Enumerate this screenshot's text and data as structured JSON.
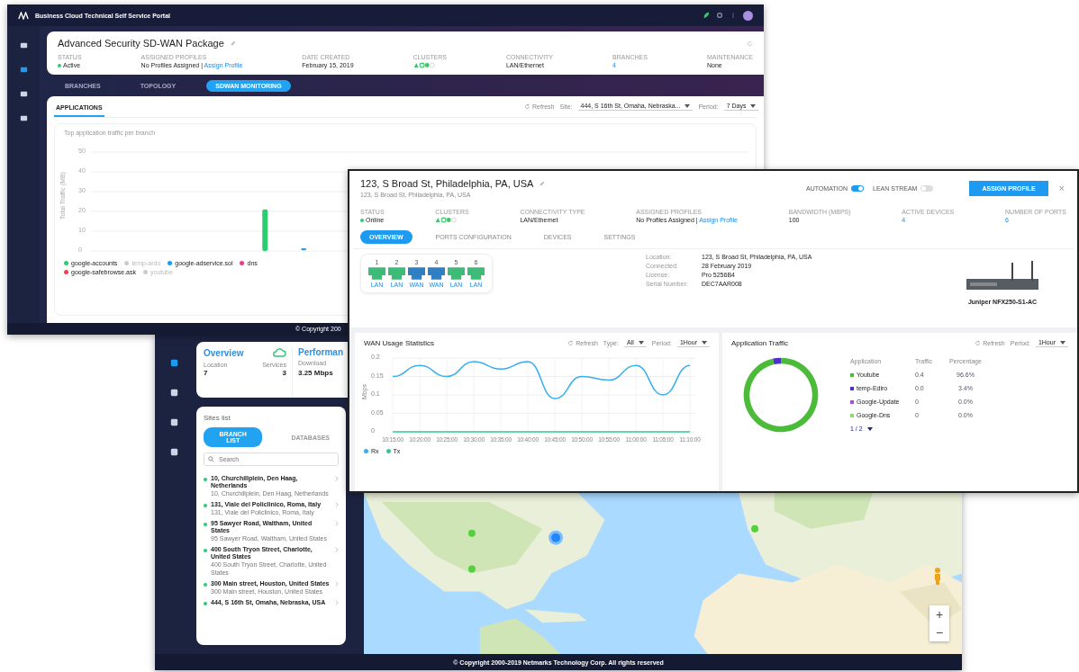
{
  "package_window": {
    "title": "Business Cloud Technical Self Service Portal",
    "sidebar": [
      {
        "selected": false
      },
      {
        "selected": true
      },
      {
        "selected": false
      },
      {
        "selected": false
      }
    ],
    "header": {
      "title": "Advanced Security SD-WAN Package",
      "fields": [
        {
          "label": "STATUS",
          "value": "Active",
          "kind": "status"
        },
        {
          "label": "ASSIGNED PROFILES",
          "value": "No Profiles Assigned |",
          "link": "Assign Profile",
          "kind": "link"
        },
        {
          "label": "DATE CREATED",
          "value": "February 15, 2019",
          "kind": "text"
        },
        {
          "label": "CLUSTERS",
          "kind": "clusters"
        },
        {
          "label": "CONNECTIVITY",
          "value": "LAN/Ethernet",
          "kind": "text"
        },
        {
          "label": "BRANCHES",
          "value": "4",
          "kind": "count"
        },
        {
          "label": "MAINTENANCE",
          "value": "None",
          "kind": "text"
        }
      ]
    },
    "tabs": [
      {
        "label": "BRANCHES",
        "selected": false
      },
      {
        "label": "TOPOLOGY",
        "selected": false
      },
      {
        "label": "SDWAN MONITORING",
        "selected": true
      }
    ],
    "subtabs": [
      {
        "label": "APPLICATIONS",
        "selected": true
      }
    ],
    "toolbar": {
      "refresh": "Refresh",
      "site_label": "Site:",
      "site": "444, S 16th St, Omaha, Nebraska...",
      "period_label": "Period:",
      "period": "7 Days"
    },
    "chart": {
      "title": "Top application traffic per branch",
      "chart_data": {
        "type": "bar",
        "ylabel": "Total Traffic (MB)",
        "ylim": [
          0,
          50
        ],
        "yticks": [
          0,
          10,
          20,
          30,
          40,
          50
        ],
        "grid": true,
        "legend": "bottom",
        "series": [
          {
            "name": "google-accounts",
            "color": "#2ecc71",
            "values": [
              null,
              null,
              null,
              null,
              21,
              null,
              null,
              null,
              null,
              null,
              null,
              null,
              null,
              null,
              null,
              null,
              null
            ]
          },
          {
            "name": "temp-ardo",
            "color": "#cccccc",
            "values": [
              null,
              null,
              null,
              null,
              null,
              null,
              null,
              null,
              null,
              null,
              null,
              null,
              null,
              null,
              null,
              null,
              null
            ]
          },
          {
            "name": "google-adservice.sol",
            "color": "#1e9bf0",
            "values": [
              null,
              null,
              null,
              null,
              null,
              1,
              null,
              null,
              null,
              null,
              null,
              null,
              null,
              null,
              null,
              null,
              null
            ]
          },
          {
            "name": "dns",
            "color": "#e83e8c",
            "values": [
              null,
              null,
              null,
              null,
              null,
              null,
              null,
              null,
              null,
              null,
              null,
              null,
              null,
              null,
              null,
              null,
              null
            ]
          },
          {
            "name": "google-safebrowse.ask",
            "color": "#f0434b",
            "values": [
              null,
              null,
              null,
              null,
              null,
              null,
              null,
              null,
              null,
              null,
              null,
              null,
              null,
              null,
              null,
              null,
              null
            ]
          },
          {
            "name": "youtube",
            "color": "#cccccc",
            "values": [
              null,
              null,
              null,
              null,
              null,
              null,
              null,
              null,
              null,
              null,
              null,
              null,
              null,
              null,
              null,
              null,
              null
            ]
          }
        ]
      },
      "legend_states": [
        {
          "hidden": false
        },
        {
          "hidden": true
        },
        {
          "hidden": false
        },
        {
          "hidden": false
        },
        {
          "hidden": false
        },
        {
          "hidden": true
        }
      ]
    },
    "footer": "© Copyright 200"
  },
  "sites_window": {
    "sidebar": [
      {
        "selected": true
      },
      {
        "selected": false
      },
      {
        "selected": false
      },
      {
        "selected": false
      }
    ],
    "overview": {
      "title": "Overview",
      "stats": [
        {
          "label": "Location",
          "value": "7"
        },
        {
          "label": "Services",
          "value": "3"
        }
      ],
      "performance_title": "Performan",
      "performance": {
        "label": "Download",
        "value": "3.25 Mbps"
      }
    },
    "sites": {
      "title": "Sites list",
      "tabs": [
        {
          "label": "BRANCH LIST",
          "selected": true
        },
        {
          "label": "DATABASES",
          "selected": false
        }
      ],
      "search": {
        "placeholder": "Search"
      },
      "items": [
        {
          "name": "10, Churchillplein, Den Haag, Netherlands",
          "address": "10, Churchillplein, Den Haag, Netherlands"
        },
        {
          "name": "131, Viale del Policlinico, Roma, Italy",
          "address": "131, Viale del Policlinico, Roma, Italy"
        },
        {
          "name": "95 Sawyer Road, Waltham, United States",
          "address": "95 Sawyer Road, Waltham, United States"
        },
        {
          "name": "400 South Tryon Street, Charlotte, United States",
          "address": "400 South Tryon Street, Charlotte, United States"
        },
        {
          "name": "300 Main street, Houston, United States",
          "address": "300 Main street, Houston, United States"
        },
        {
          "name": "444, S 16th St, Omaha, Nebraska, USA"
        }
      ]
    },
    "map": {
      "zoom_in": "+",
      "zoom_out": "−"
    },
    "footer": "© Copyright 2000-2019 Netmarks Technology Corp. All rights reserved"
  },
  "site_window": {
    "title": "123, S Broad St, Philadelphia, PA, USA",
    "subtitle": "123, S Broad St, Philadelphia, PA, USA",
    "toggles": [
      {
        "label": "AUTOMATION",
        "on": true
      },
      {
        "label": "LEAN STREAM",
        "on": false
      }
    ],
    "assign_button": "ASSIGN PROFILE",
    "close": "×",
    "fields": [
      {
        "label": "STATUS",
        "value": "Online",
        "kind": "status"
      },
      {
        "label": "CLUSTERS",
        "kind": "clusters"
      },
      {
        "label": "CONNECTIVITY TYPE",
        "value": "LAN/Ethernet",
        "kind": "text"
      },
      {
        "label": "ASSIGNED PROFILES",
        "value": "No Profiles Assigned |",
        "link": "Assign Profile",
        "kind": "link"
      },
      {
        "label": "BANDWIDTH (MBPS)",
        "value": "100",
        "kind": "text"
      },
      {
        "label": "ACTIVE DEVICES",
        "value": "4",
        "kind": "count"
      },
      {
        "label": "NUMBER OF PORTS",
        "value": "6",
        "kind": "count"
      }
    ],
    "tabs": [
      {
        "label": "OVERVIEW",
        "selected": true
      },
      {
        "label": "PORTS CONFIGURATION",
        "selected": false
      },
      {
        "label": "DEVICES",
        "selected": false
      },
      {
        "label": "SETTINGS",
        "selected": false
      }
    ],
    "ports": [
      {
        "number": "1",
        "label": "LAN",
        "color": "#3dbb78"
      },
      {
        "number": "2",
        "label": "LAN",
        "color": "#3dbb78"
      },
      {
        "number": "3",
        "label": "WAN",
        "color": "#2f7fc4"
      },
      {
        "number": "4",
        "label": "WAN",
        "color": "#2f7fc4"
      },
      {
        "number": "5",
        "label": "LAN",
        "color": "#3dbb78"
      },
      {
        "number": "6",
        "label": "LAN",
        "color": "#3dbb78"
      }
    ],
    "info": [
      {
        "label": "Location:",
        "value": "123, S Broad St, Philadelphia, PA, USA"
      },
      {
        "label": "Connected:",
        "value": "28 February 2019"
      },
      {
        "label": "License:",
        "value": "Pro 5256B4"
      },
      {
        "label": "Serial Number:",
        "value": "DEC7AAR008"
      }
    ],
    "device": {
      "name": "Juniper NFX250-S1-AC"
    },
    "wan": {
      "title": "WAN Usage Statistics",
      "refresh": "Refresh",
      "type_label": "Type:",
      "type": "All",
      "period_label": "Period:",
      "period": "1Hour",
      "chart_data": {
        "type": "line",
        "ylabel": "Mbps",
        "categories": [
          "10:15:00",
          "10:20:00",
          "10:25:00",
          "10:30:00",
          "10:35:00",
          "10:40:00",
          "10:45:00",
          "10:50:00",
          "10:55:00",
          "11:00:00",
          "11:05:00",
          "11:10:00"
        ],
        "ylim": [
          0,
          0.2
        ],
        "yticks": [
          0,
          0.05,
          0.1,
          0.15,
          0.2
        ],
        "grid": true,
        "legend": "bottom",
        "series": [
          {
            "name": "Rx",
            "color": "#36aef0",
            "values": [
              0.15,
              0.18,
              0.15,
              0.19,
              0.17,
              0.19,
              0.09,
              0.15,
              0.14,
              0.18,
              0.1,
              0.18
            ]
          },
          {
            "name": "Tx",
            "color": "#2ecc8f",
            "values": [
              0,
              0,
              0,
              0,
              0,
              0,
              0,
              0,
              0,
              0,
              0,
              0
            ]
          }
        ]
      }
    },
    "traffic": {
      "title": "Application Traffic",
      "refresh": "Refresh",
      "period_label": "Period:",
      "period": "1Hour",
      "columns": [
        "Application",
        "Traffic",
        "Percentage"
      ],
      "rows": [
        {
          "traffic": "0.4",
          "percentage": "96.6%"
        },
        {
          "traffic": "0.0",
          "percentage": "3.4%"
        },
        {
          "traffic": "0",
          "percentage": "0.0%"
        },
        {
          "traffic": "0",
          "percentage": "0.0%"
        }
      ],
      "pager": "1 / 2",
      "chart_data": {
        "type": "donut",
        "categories": [
          "Youtube",
          "temp-Ediro",
          "Google-Update",
          "Google-Dns"
        ],
        "values": [
          96.6,
          3.4,
          0,
          0
        ],
        "legend": "right",
        "colors": [
          "#4cbb3a",
          "#4b2fd0",
          "#a64de0",
          "#8fd86a"
        ]
      }
    }
  }
}
